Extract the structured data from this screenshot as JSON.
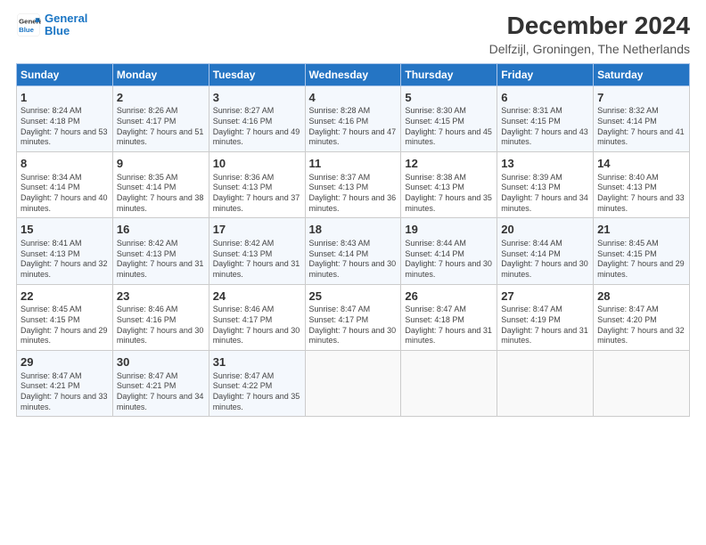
{
  "logo": {
    "line1": "General",
    "line2": "Blue"
  },
  "title": "December 2024",
  "subtitle": "Delfzijl, Groningen, The Netherlands",
  "days_of_week": [
    "Sunday",
    "Monday",
    "Tuesday",
    "Wednesday",
    "Thursday",
    "Friday",
    "Saturday"
  ],
  "weeks": [
    [
      {
        "day": 1,
        "sunrise": "8:24 AM",
        "sunset": "4:18 PM",
        "daylight": "7 hours and 53 minutes."
      },
      {
        "day": 2,
        "sunrise": "8:26 AM",
        "sunset": "4:17 PM",
        "daylight": "7 hours and 51 minutes."
      },
      {
        "day": 3,
        "sunrise": "8:27 AM",
        "sunset": "4:16 PM",
        "daylight": "7 hours and 49 minutes."
      },
      {
        "day": 4,
        "sunrise": "8:28 AM",
        "sunset": "4:16 PM",
        "daylight": "7 hours and 47 minutes."
      },
      {
        "day": 5,
        "sunrise": "8:30 AM",
        "sunset": "4:15 PM",
        "daylight": "7 hours and 45 minutes."
      },
      {
        "day": 6,
        "sunrise": "8:31 AM",
        "sunset": "4:15 PM",
        "daylight": "7 hours and 43 minutes."
      },
      {
        "day": 7,
        "sunrise": "8:32 AM",
        "sunset": "4:14 PM",
        "daylight": "7 hours and 41 minutes."
      }
    ],
    [
      {
        "day": 8,
        "sunrise": "8:34 AM",
        "sunset": "4:14 PM",
        "daylight": "7 hours and 40 minutes."
      },
      {
        "day": 9,
        "sunrise": "8:35 AM",
        "sunset": "4:14 PM",
        "daylight": "7 hours and 38 minutes."
      },
      {
        "day": 10,
        "sunrise": "8:36 AM",
        "sunset": "4:13 PM",
        "daylight": "7 hours and 37 minutes."
      },
      {
        "day": 11,
        "sunrise": "8:37 AM",
        "sunset": "4:13 PM",
        "daylight": "7 hours and 36 minutes."
      },
      {
        "day": 12,
        "sunrise": "8:38 AM",
        "sunset": "4:13 PM",
        "daylight": "7 hours and 35 minutes."
      },
      {
        "day": 13,
        "sunrise": "8:39 AM",
        "sunset": "4:13 PM",
        "daylight": "7 hours and 34 minutes."
      },
      {
        "day": 14,
        "sunrise": "8:40 AM",
        "sunset": "4:13 PM",
        "daylight": "7 hours and 33 minutes."
      }
    ],
    [
      {
        "day": 15,
        "sunrise": "8:41 AM",
        "sunset": "4:13 PM",
        "daylight": "7 hours and 32 minutes."
      },
      {
        "day": 16,
        "sunrise": "8:42 AM",
        "sunset": "4:13 PM",
        "daylight": "7 hours and 31 minutes."
      },
      {
        "day": 17,
        "sunrise": "8:42 AM",
        "sunset": "4:13 PM",
        "daylight": "7 hours and 31 minutes."
      },
      {
        "day": 18,
        "sunrise": "8:43 AM",
        "sunset": "4:14 PM",
        "daylight": "7 hours and 30 minutes."
      },
      {
        "day": 19,
        "sunrise": "8:44 AM",
        "sunset": "4:14 PM",
        "daylight": "7 hours and 30 minutes."
      },
      {
        "day": 20,
        "sunrise": "8:44 AM",
        "sunset": "4:14 PM",
        "daylight": "7 hours and 30 minutes."
      },
      {
        "day": 21,
        "sunrise": "8:45 AM",
        "sunset": "4:15 PM",
        "daylight": "7 hours and 29 minutes."
      }
    ],
    [
      {
        "day": 22,
        "sunrise": "8:45 AM",
        "sunset": "4:15 PM",
        "daylight": "7 hours and 29 minutes."
      },
      {
        "day": 23,
        "sunrise": "8:46 AM",
        "sunset": "4:16 PM",
        "daylight": "7 hours and 30 minutes."
      },
      {
        "day": 24,
        "sunrise": "8:46 AM",
        "sunset": "4:17 PM",
        "daylight": "7 hours and 30 minutes."
      },
      {
        "day": 25,
        "sunrise": "8:47 AM",
        "sunset": "4:17 PM",
        "daylight": "7 hours and 30 minutes."
      },
      {
        "day": 26,
        "sunrise": "8:47 AM",
        "sunset": "4:18 PM",
        "daylight": "7 hours and 31 minutes."
      },
      {
        "day": 27,
        "sunrise": "8:47 AM",
        "sunset": "4:19 PM",
        "daylight": "7 hours and 31 minutes."
      },
      {
        "day": 28,
        "sunrise": "8:47 AM",
        "sunset": "4:20 PM",
        "daylight": "7 hours and 32 minutes."
      }
    ],
    [
      {
        "day": 29,
        "sunrise": "8:47 AM",
        "sunset": "4:21 PM",
        "daylight": "7 hours and 33 minutes."
      },
      {
        "day": 30,
        "sunrise": "8:47 AM",
        "sunset": "4:21 PM",
        "daylight": "7 hours and 34 minutes."
      },
      {
        "day": 31,
        "sunrise": "8:47 AM",
        "sunset": "4:22 PM",
        "daylight": "7 hours and 35 minutes."
      },
      null,
      null,
      null,
      null
    ]
  ]
}
